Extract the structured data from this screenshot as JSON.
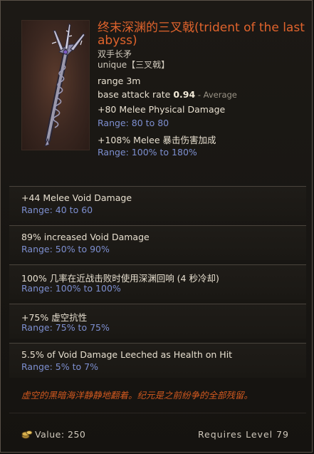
{
  "item": {
    "name": "终末深渊的三叉戟(trident of the last abyss)",
    "type": "双手长矛",
    "rarity": "unique【三叉戟】",
    "icon": "trident-icon"
  },
  "base_stats": {
    "range_text": "range 3m",
    "attack_rate_label": "base attack rate ",
    "attack_rate_value": "0.94",
    "attack_rate_suffix": " - Average",
    "implicit1": "+80 Melee Physical Damage",
    "implicit1_range": "Range: 80 to 80",
    "implicit2": "+108% Melee 暴击伤害加成",
    "implicit2_range": "Range: 100% to 180%"
  },
  "affixes": [
    {
      "name": "+44 Melee Void Damage",
      "range": "Range: 40 to 60"
    },
    {
      "name": "89% increased Void Damage",
      "range": "Range: 50% to 90%"
    },
    {
      "name": "100% 几率在近战击败时使用深渊回响 (4 秒冷却)",
      "range": "Range: 100% to 100%"
    },
    {
      "name": "+75% 虚空抗性",
      "range": "Range: 75% to 75%"
    },
    {
      "name": "5.5% of Void Damage Leeched as Health on Hit",
      "range": "Range: 5% to 7%"
    }
  ],
  "lore": "虚空的黑暗海洋静静地翻着。纪元是之前纷争的全部残留。",
  "footer": {
    "value_text": "Value: 250",
    "coin_icon": "coin-icon",
    "requires_text": "Requires Level 79"
  },
  "colors": {
    "unique_name": "#e0632c",
    "range_blue": "#7d8fd0",
    "lore_orange": "#d2591f"
  }
}
